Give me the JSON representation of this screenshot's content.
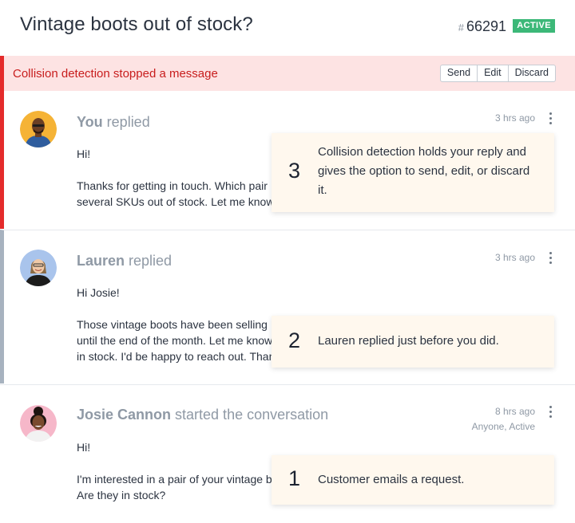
{
  "header": {
    "title": "Vintage boots out of stock?",
    "ticket_hash": "#",
    "ticket_number": "66291",
    "status_badge": "ACTIVE"
  },
  "banner": {
    "message": "Collision detection stopped a message",
    "actions": {
      "send": "Send",
      "edit": "Edit",
      "discard": "Discard"
    }
  },
  "messages": [
    {
      "author": "You",
      "action": " replied",
      "time": "3 hrs ago",
      "paragraphs": [
        "Hi!",
        "Thanks for getting in touch. Which pair",
        "several SKUs out of stock. Let me know"
      ]
    },
    {
      "author": "Lauren",
      "action": " replied",
      "time": "3 hrs ago",
      "paragraphs": [
        "Hi Josie!",
        "Those vintage boots have been selling",
        "until the end of the month. Let me know",
        "in stock. I'd be happy to reach out. Than"
      ]
    },
    {
      "author": "Josie Cannon",
      "action": " started the conversation",
      "time": "8 hrs ago",
      "sub_time": "Anyone, Active",
      "paragraphs": [
        "Hi!",
        "I'm interested in a pair of your vintage b",
        "Are they in stock?"
      ]
    }
  ],
  "callouts": [
    {
      "number": "3",
      "text": "Collision detection holds your reply and gives the option to send, edit, or discard it."
    },
    {
      "number": "2",
      "text": "Lauren replied just before you did."
    },
    {
      "number": "1",
      "text": "Customer emails a request."
    }
  ],
  "colors": {
    "active_badge": "#3cb878",
    "collision_red": "#e42b2b",
    "banner_bg": "#fde3e3",
    "callout_bg": "#fff8ee"
  }
}
